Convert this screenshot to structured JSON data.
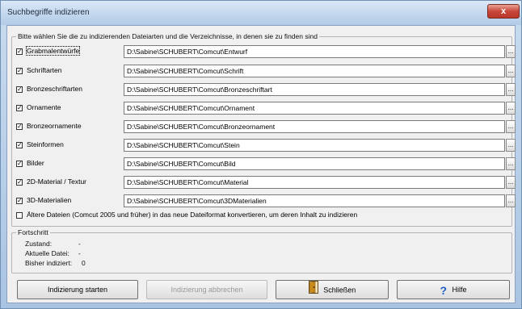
{
  "window": {
    "title": "Suchbegriffe indizieren",
    "close_label": "x"
  },
  "files_group": {
    "legend": "Bitte wählen Sie die zu indizierenden Dateiarten und die Verzeichnisse, in denen sie zu finden sind",
    "rows": [
      {
        "label": "Grabmalentwürfe",
        "checked": true,
        "path": "D:\\Sabine\\SCHUBERT\\Comcut\\Entwurf"
      },
      {
        "label": "Schriftarten",
        "checked": true,
        "path": "D:\\Sabine\\SCHUBERT\\Comcut\\Schrift"
      },
      {
        "label": "Bronzeschriftarten",
        "checked": true,
        "path": "D:\\Sabine\\SCHUBERT\\Comcut\\Bronzeschriftart"
      },
      {
        "label": "Ornamente",
        "checked": true,
        "path": "D:\\Sabine\\SCHUBERT\\Comcut\\Ornament"
      },
      {
        "label": "Bronzeornamente",
        "checked": true,
        "path": "D:\\Sabine\\SCHUBERT\\Comcut\\Bronzeornament"
      },
      {
        "label": "Steinformen",
        "checked": true,
        "path": "D:\\Sabine\\SCHUBERT\\Comcut\\Stein"
      },
      {
        "label": "Bilder",
        "checked": true,
        "path": "D:\\Sabine\\SCHUBERT\\Comcut\\Bild"
      },
      {
        "label": "2D-Material / Textur",
        "checked": true,
        "path": "D:\\Sabine\\SCHUBERT\\Comcut\\Material"
      },
      {
        "label": "3D-Materialien",
        "checked": true,
        "path": "D:\\Sabine\\SCHUBERT\\Comcut\\3DMaterialien"
      }
    ],
    "browse_label": "...",
    "convert_label": "Ältere Dateien (Comcut 2005 und früher) in das neue Dateiformat konvertieren, um deren Inhalt zu indizieren",
    "convert_checked": false
  },
  "progress_group": {
    "legend": "Fortschritt",
    "status_label": "Zustand:",
    "status_value": "-",
    "current_file_label": "Aktuelle Datei:",
    "current_file_value": "-",
    "indexed_label": "Bisher indiziert:",
    "indexed_value": "0"
  },
  "buttons": {
    "start": "Indizierung starten",
    "cancel": "Indizierung abbrechen",
    "close": "Schließen",
    "help": "Hilfe"
  },
  "icons": {
    "close_icon": "door-exit-icon",
    "help_icon": "question-mark-icon"
  },
  "colors": {
    "title_bar": "#c3d7ee",
    "close_button": "#c7473a",
    "dialog_bg": "#f0f0f0",
    "help_icon": "#1f5fbf",
    "exit_icon": "#c98a1a"
  }
}
